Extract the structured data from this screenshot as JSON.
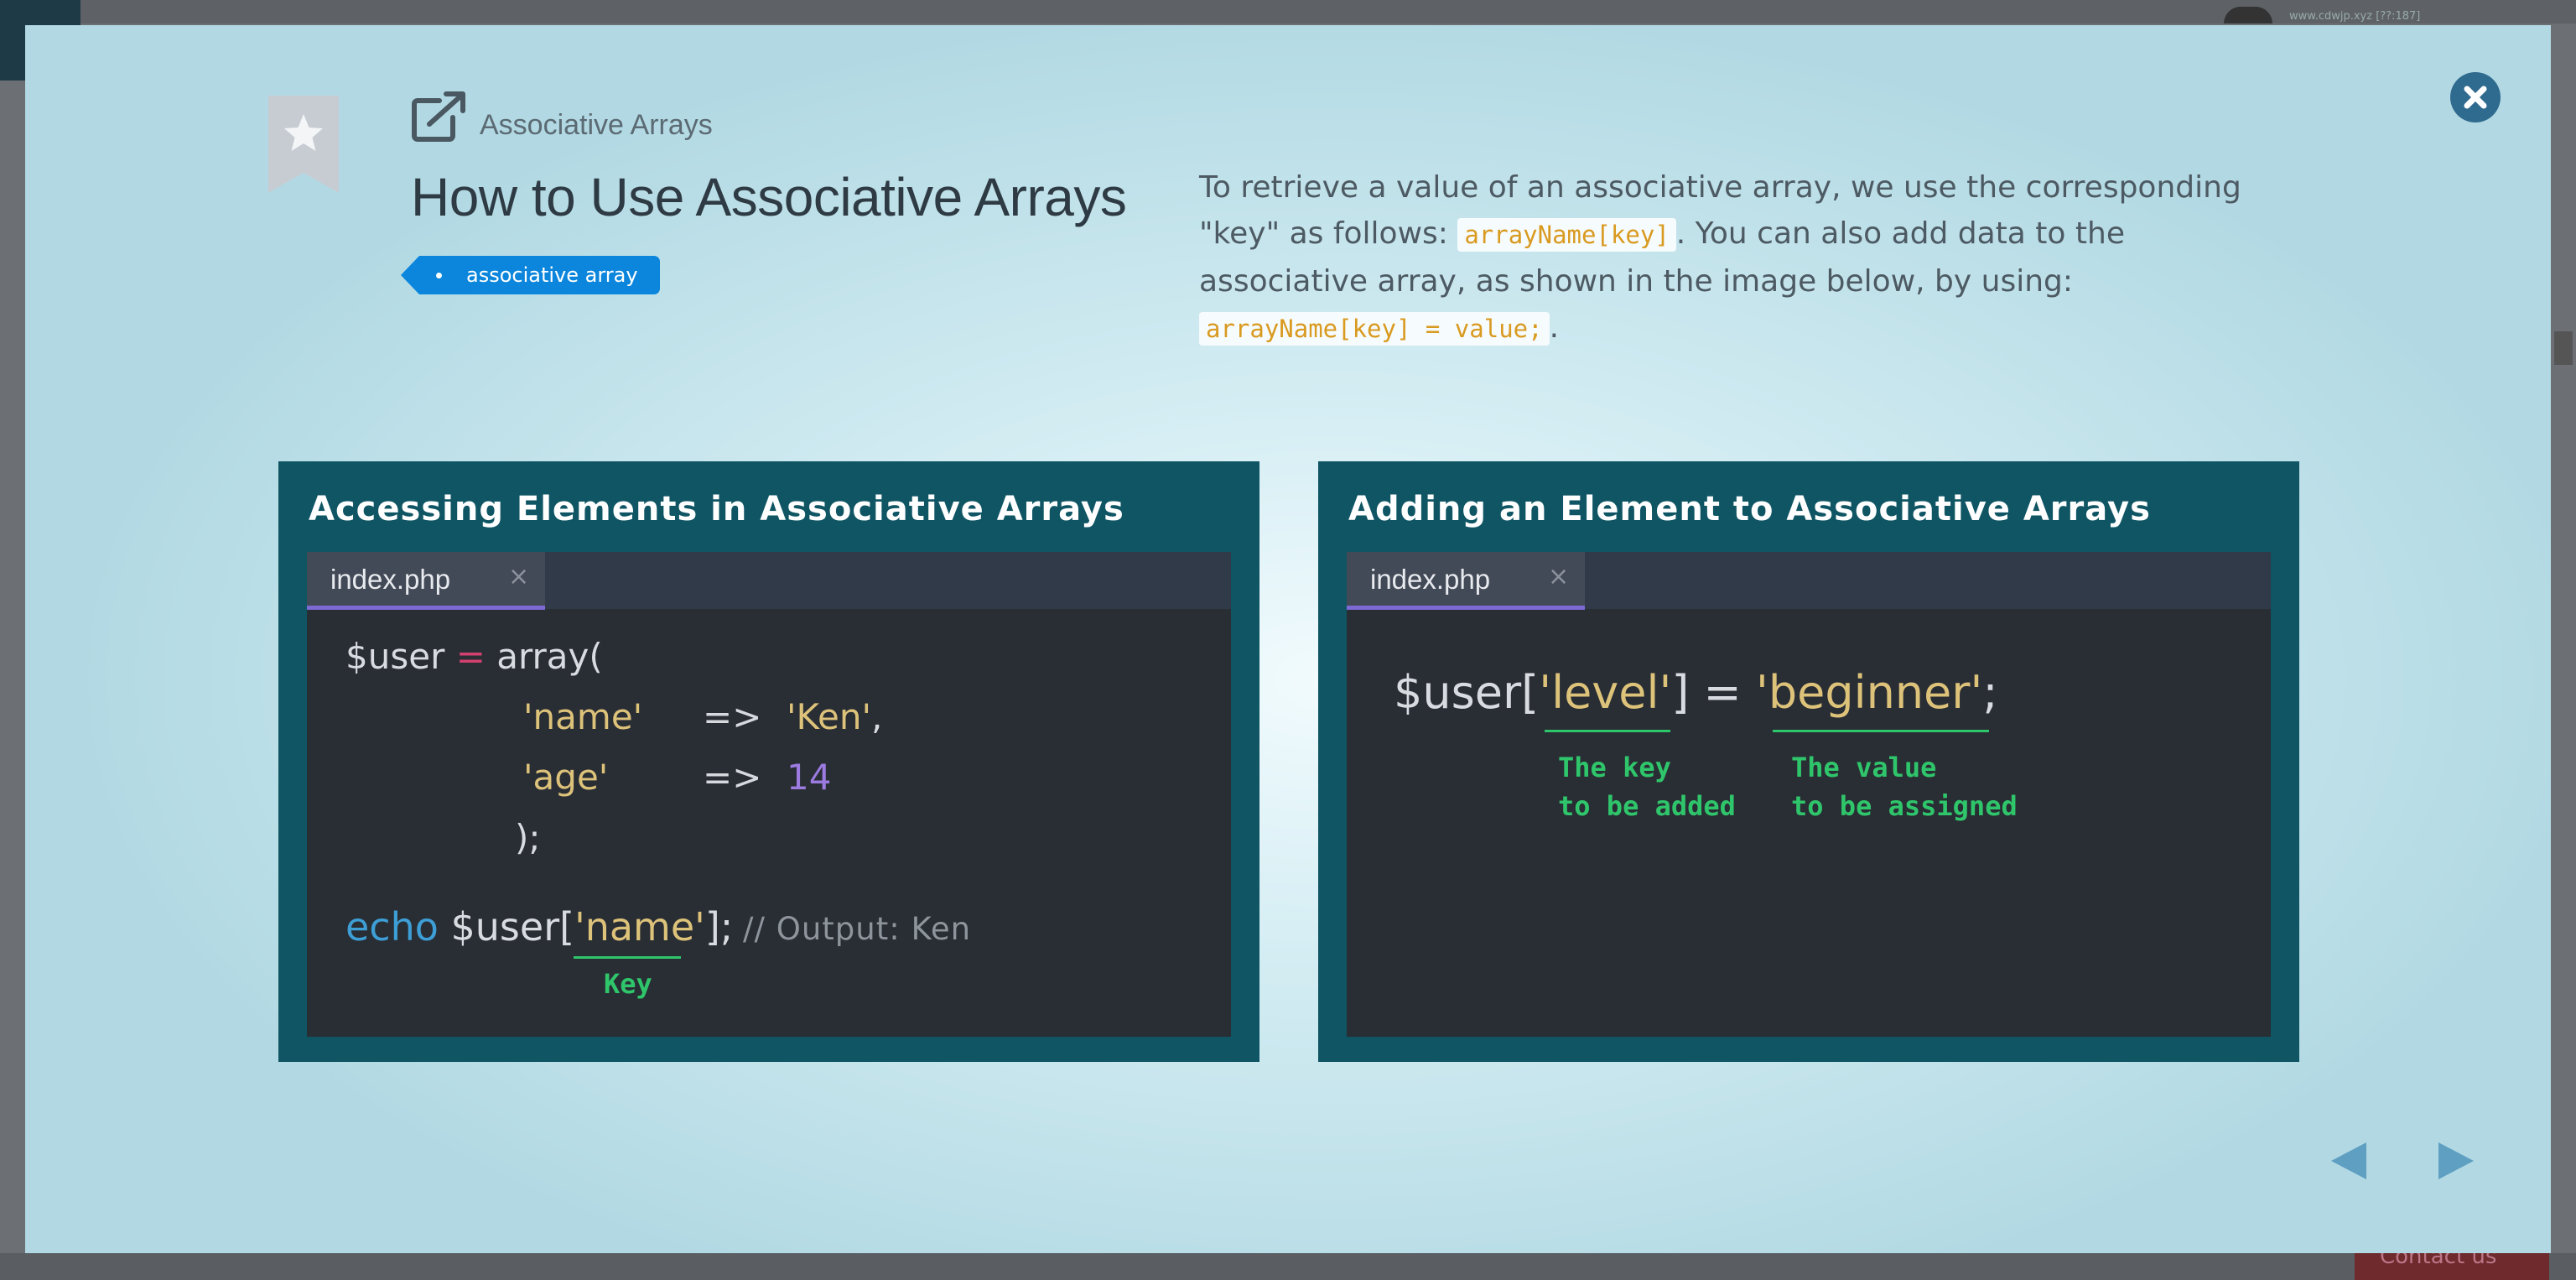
{
  "background": {
    "url_text": "www.cdwjp.xyz [??:187]",
    "contact_label": "Contact us"
  },
  "header": {
    "breadcrumb": "Associative Arrays",
    "title": "How to Use Associative Arrays",
    "tag": "associative array"
  },
  "description": {
    "part1": "To retrieve a value of an associative array, we use the corresponding \"key\" as follows: ",
    "code1": "arrayName[key]",
    "part2": ". You can also add data to the associative array, as shown in the image below, by using: ",
    "code2": "arrayName[key] = value;",
    "part3": "."
  },
  "figure_left": {
    "heading": "Accessing Elements in Associative Arrays",
    "tab_name": "index.php",
    "tab_close": "×",
    "code": {
      "l1_var": "$user",
      "l1_eq": " = ",
      "l1_fn": "array(",
      "l2_key": "'name'",
      "l2_arrow": "=>",
      "l2_val": "'Ken'",
      "l2_comma": ",",
      "l3_key": "'age'",
      "l3_arrow": "=>",
      "l3_val": "14",
      "l4_close": ");",
      "l5_echo": "echo",
      "l5_var": " $user[",
      "l5_key": "'name'",
      "l5_end": "];",
      "l5_comment": "// Output: Ken"
    },
    "annotation_key": "Key"
  },
  "figure_right": {
    "heading": "Adding an Element to Associative Arrays",
    "tab_name": "index.php",
    "tab_close": "×",
    "code": {
      "var": "$user[",
      "key": "'level'",
      "mid": "] = ",
      "val": "'beginner'",
      "end": ";"
    },
    "annotation_key": "The key\nto be added",
    "annotation_value": "The value\nto be assigned"
  },
  "colors": {
    "accent": "#0c86dc",
    "panel": "#0f5564",
    "editor": "#292d34",
    "annotation": "#2fc56b",
    "close_button": "#2f6a8f",
    "nav_arrow": "#5e9fc2"
  },
  "icons": {
    "bookmark": "bookmark-star-icon",
    "external": "external-link-icon",
    "close": "close-icon",
    "prev": "prev-arrow-icon",
    "next": "next-arrow-icon"
  }
}
